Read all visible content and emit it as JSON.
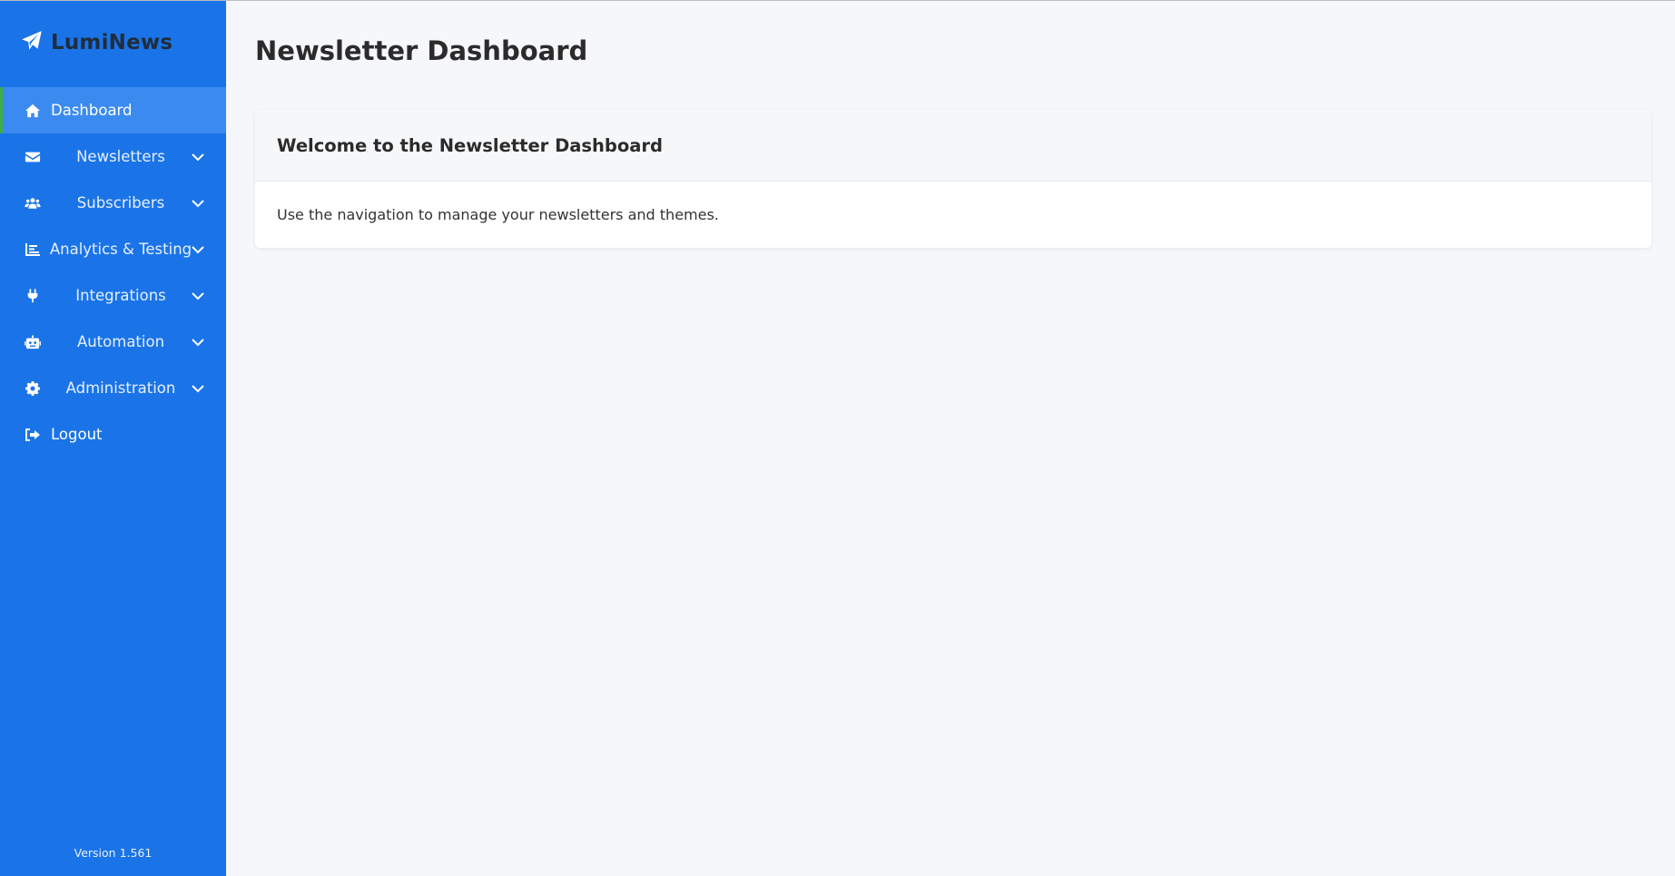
{
  "brand": {
    "name": "LumiNews",
    "icon": "paper-plane-icon"
  },
  "colors": {
    "sidebar": "#1a74e8",
    "sidebar_active": "#3b8af0",
    "active_indicator": "#3fae49",
    "background": "#f5f7fa",
    "text": "#2b2b2b"
  },
  "sidebar": {
    "items": [
      {
        "label": "Dashboard",
        "icon": "home-icon",
        "active": true,
        "expandable": false
      },
      {
        "label": "Newsletters",
        "icon": "envelope-icon",
        "active": false,
        "expandable": true
      },
      {
        "label": "Subscribers",
        "icon": "users-icon",
        "active": false,
        "expandable": true
      },
      {
        "label": "Analytics & Testing",
        "icon": "chart-icon",
        "active": false,
        "expandable": true
      },
      {
        "label": "Integrations",
        "icon": "plug-icon",
        "active": false,
        "expandable": true
      },
      {
        "label": "Automation",
        "icon": "robot-icon",
        "active": false,
        "expandable": true
      },
      {
        "label": "Administration",
        "icon": "gear-icon",
        "active": false,
        "expandable": true
      },
      {
        "label": "Logout",
        "icon": "logout-icon",
        "active": false,
        "expandable": false
      }
    ],
    "version": "Version 1.561"
  },
  "main": {
    "title": "Newsletter Dashboard",
    "card": {
      "title": "Welcome to the Newsletter Dashboard",
      "body": "Use the navigation to manage your newsletters and themes."
    }
  }
}
